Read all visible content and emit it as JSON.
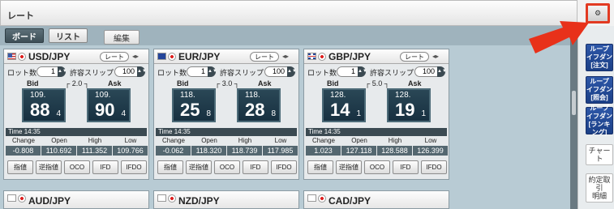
{
  "window": {
    "title": "レート"
  },
  "tabs": {
    "board": "ボード",
    "list": "リスト",
    "edit": "編集"
  },
  "panel_labels": {
    "rate_button": "レート",
    "lot": "ロット数",
    "slip": "許容スリップ",
    "bid": "Bid",
    "ask": "Ask",
    "time": "Time",
    "change": "Change",
    "open": "Open",
    "high": "High",
    "low": "Low",
    "orders": [
      "指値",
      "逆指値",
      "OCO",
      "IFD",
      "IFDO"
    ]
  },
  "panels": [
    {
      "pair": "USD/JPY",
      "flag": "us",
      "lot": "1",
      "slip": "100",
      "spread": "2.0",
      "bid": {
        "big": "109.",
        "mid": "88",
        "small": "4"
      },
      "ask": {
        "big": "109.",
        "mid": "90",
        "small": "4"
      },
      "time": "14:35",
      "change": "-0.808",
      "open": "110.692",
      "high": "111.352",
      "low": "109.766"
    },
    {
      "pair": "EUR/JPY",
      "flag": "eu",
      "lot": "1",
      "slip": "100",
      "spread": "3.0",
      "bid": {
        "big": "118.",
        "mid": "25",
        "small": "8"
      },
      "ask": {
        "big": "118.",
        "mid": "28",
        "small": "8"
      },
      "time": "14:35",
      "change": "-0.062",
      "open": "118.320",
      "high": "118.739",
      "low": "117.985"
    },
    {
      "pair": "GBP/JPY",
      "flag": "gb",
      "lot": "1",
      "slip": "100",
      "spread": "5.0",
      "bid": {
        "big": "128.",
        "mid": "14",
        "small": "1"
      },
      "ask": {
        "big": "128.",
        "mid": "19",
        "small": "1"
      },
      "time": "14:35",
      "change": "1.023",
      "open": "127.118",
      "high": "128.588",
      "low": "126.399"
    }
  ],
  "mini_panels": [
    {
      "pair": "AUD/JPY"
    },
    {
      "pair": "NZD/JPY"
    },
    {
      "pair": "CAD/JPY"
    }
  ],
  "sidebar": {
    "btn1": "ループ\nイフダン\n[注文]",
    "btn2": "ループ\nイフダン\n[照会]",
    "btn3": "ループ\nイフダン\n[ランキング]",
    "chart": "チャート",
    "settled": "約定取引\n明細"
  }
}
